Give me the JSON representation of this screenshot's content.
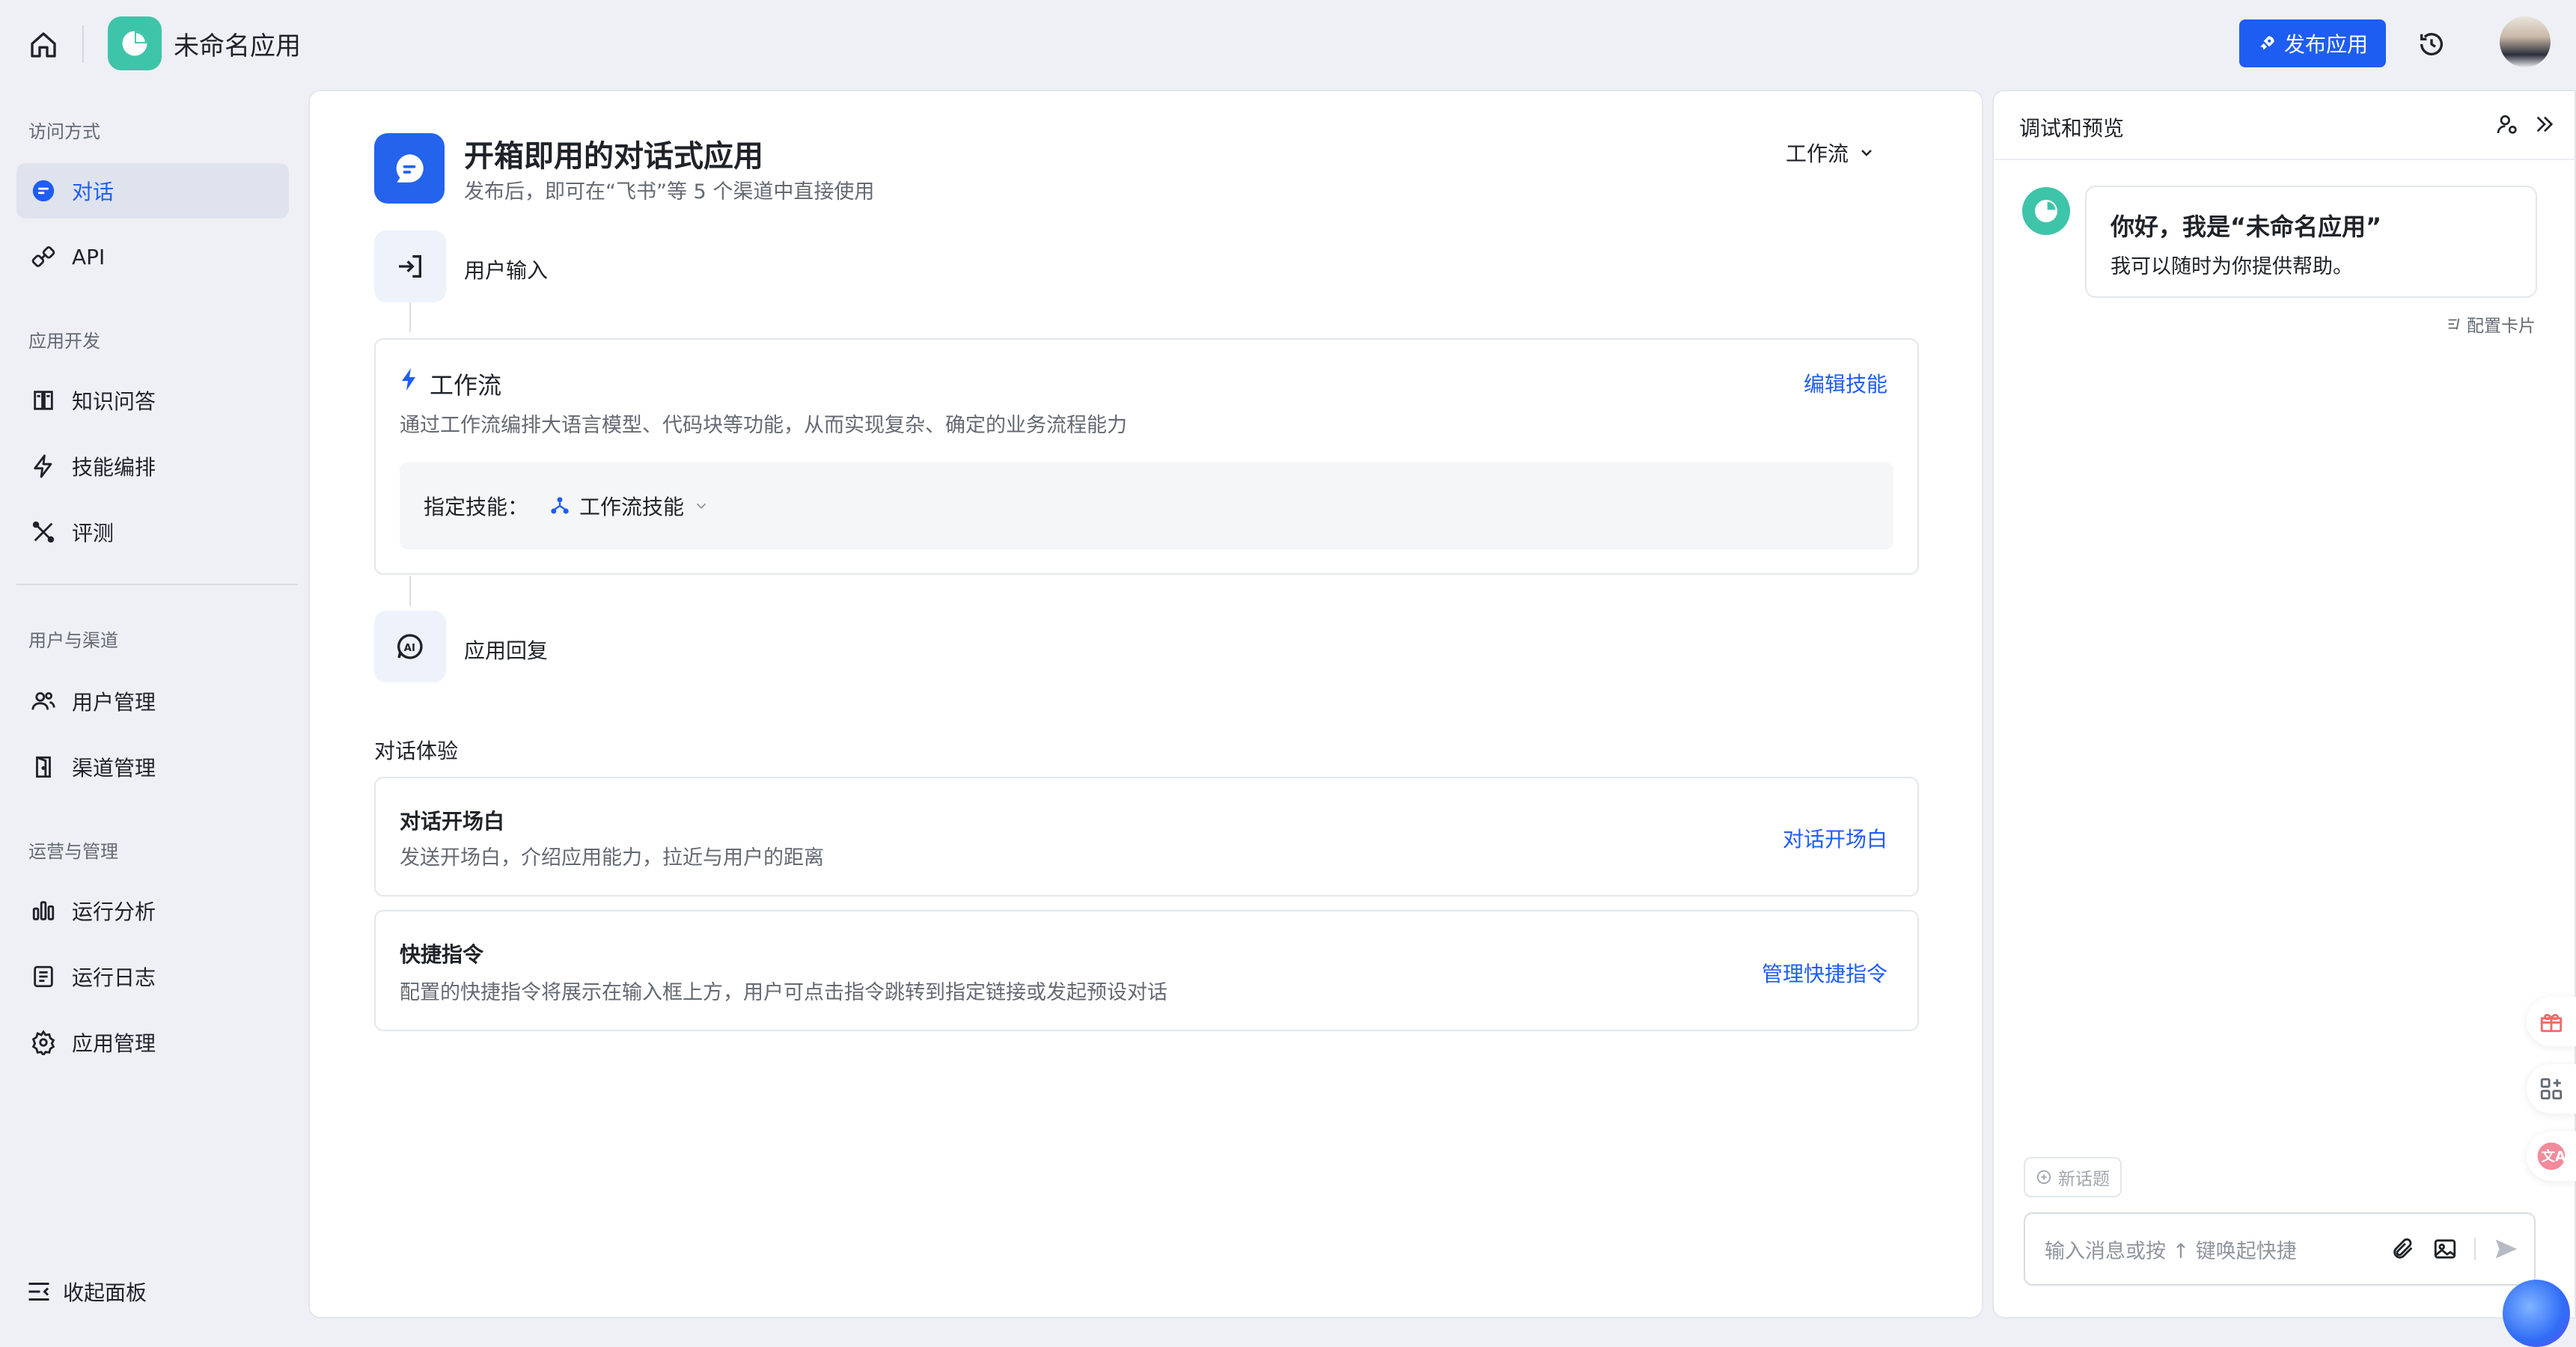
{
  "topbar": {
    "app_name": "未命名应用",
    "publish_label": "发布应用"
  },
  "sidebar": {
    "sections": [
      {
        "title": "访问方式"
      },
      {
        "title": "应用开发"
      },
      {
        "title": "用户与渠道"
      },
      {
        "title": "运营与管理"
      }
    ],
    "items": [
      {
        "label": "对话",
        "icon": "chat-icon",
        "active": true
      },
      {
        "label": "API",
        "icon": "link-icon"
      },
      {
        "label": "知识问答",
        "icon": "book-icon"
      },
      {
        "label": "技能编排",
        "icon": "lightning-icon"
      },
      {
        "label": "评测",
        "icon": "tools-icon"
      },
      {
        "label": "用户管理",
        "icon": "users-icon"
      },
      {
        "label": "渠道管理",
        "icon": "door-icon"
      },
      {
        "label": "运行分析",
        "icon": "bar-chart-icon"
      },
      {
        "label": "运行日志",
        "icon": "log-icon"
      },
      {
        "label": "应用管理",
        "icon": "gear-icon"
      }
    ],
    "collapse_label": "收起面板"
  },
  "main": {
    "title": "开箱即用的对话式应用",
    "subtitle": "发布后，即可在“飞书”等 5 个渠道中直接使用",
    "mode": "工作流",
    "step_input": "用户输入",
    "workflow_card": {
      "title": "工作流",
      "desc": "通过工作流编排大语言模型、代码块等功能，从而实现复杂、确定的业务流程能力",
      "link": "编辑技能",
      "skill_label": "指定技能：",
      "skill_value": "工作流技能"
    },
    "step_reply": "应用回复",
    "experience_label": "对话体验",
    "opening_card": {
      "title": "对话开场白",
      "desc": "发送开场白，介绍应用能力，拉近与用户的距离",
      "link": "对话开场白"
    },
    "shortcut_card": {
      "title": "快捷指令",
      "desc": "配置的快捷指令将展示在输入框上方，用户可点击指令跳转到指定链接或发起预设对话",
      "link": "管理快捷指令"
    }
  },
  "preview": {
    "title": "调试和预览",
    "greeting_title": "你好，我是“未命名应用”",
    "greeting_body": "我可以随时为你提供帮助。",
    "config_card": "配置卡片",
    "new_topic": "新话题",
    "input_placeholder": "输入消息或按 ↑ 键唤起快捷"
  },
  "colors": {
    "accent": "#1e5df2",
    "app_logo": "#3ec4a9",
    "background": "#eef0f6"
  }
}
